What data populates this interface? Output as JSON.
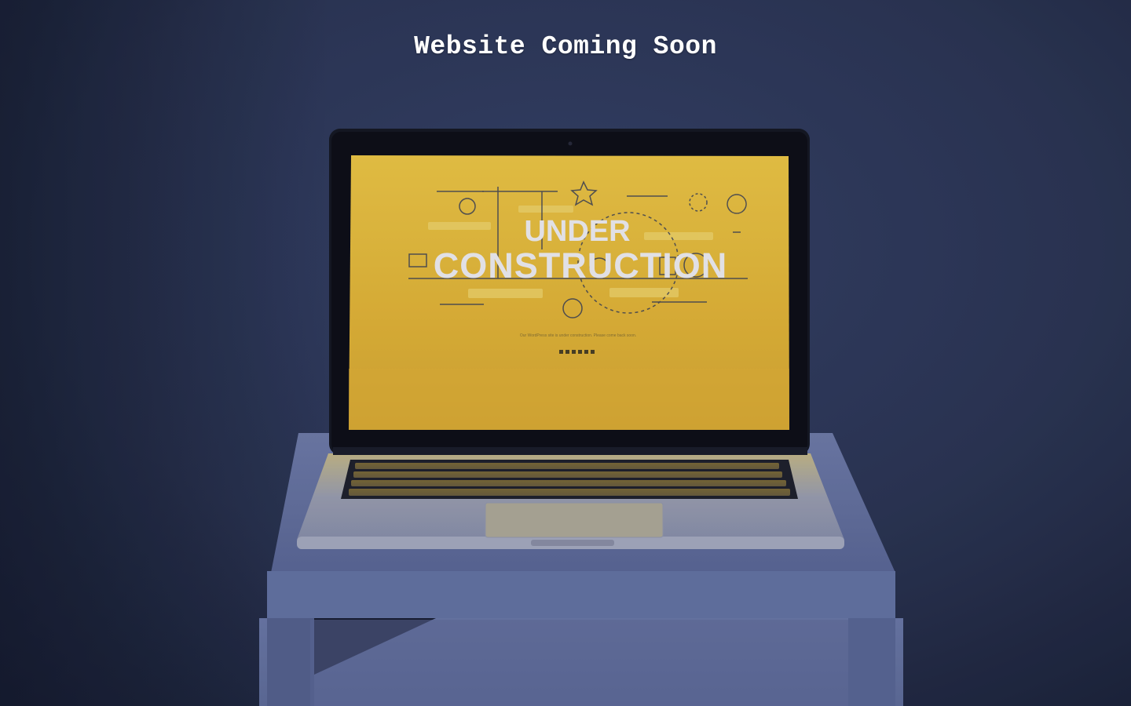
{
  "page": {
    "title": "Website Coming Soon"
  },
  "screen": {
    "headline_line1": "UNDER",
    "headline_line2": "CONSTRUCTION",
    "body_text": "Our WordPress site is under construction. Please come back soon.",
    "social_icons": [
      "facebook-icon",
      "twitter-icon",
      "google-plus-icon",
      "linkedin-icon",
      "youtube-icon",
      "instagram-icon"
    ]
  },
  "colors": {
    "background": "#2c3552",
    "screen_yellow": "#e6b736",
    "title_text": "#ffffff"
  }
}
